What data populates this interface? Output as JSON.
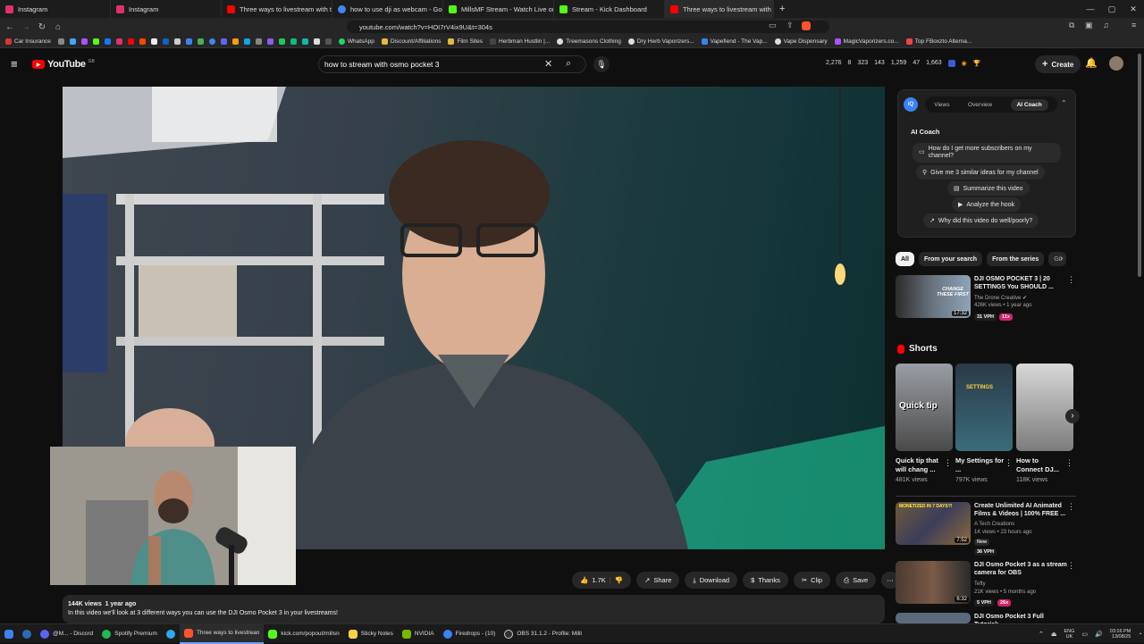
{
  "browser": {
    "tabs": [
      {
        "label": "Instagram",
        "color": "#e1306c"
      },
      {
        "label": "Instagram",
        "color": "#e1306c"
      },
      {
        "label": "Three ways to livestream with the DJI",
        "color": "#ff0000"
      },
      {
        "label": "how to use dji as webcam - Google S",
        "color": "#4285f4"
      },
      {
        "label": "MillsMF Stream - Watch Live on Kick",
        "color": "#53fc18"
      },
      {
        "label": "Stream - Kick Dashboard",
        "color": "#53fc18"
      },
      {
        "label": "Three ways to livestream with",
        "color": "#ff0000"
      }
    ],
    "url": "youtube.com/watch?v=HOI7rV4ix9U&t=304s",
    "bookmarks": [
      "Car Insurance",
      "WhatsApp",
      "Discount/Affiliations",
      "Film Sites",
      "Herbman Hustlin |...",
      "Treemasons Clothing",
      "Dry Herb Vaporizers...",
      "Vapefiend - The Vap...",
      "Vape Dispensary",
      "MagicVaporizers.co...",
      "Top FBoxzto Alterna..."
    ]
  },
  "youtube": {
    "logo": "YouTube",
    "country": "GB",
    "search_value": "how to stream with osmo pocket 3",
    "stats": [
      "2,276",
      "8",
      "323",
      "143",
      "1,259",
      "47",
      "1,663"
    ],
    "create_label": "Create"
  },
  "video": {
    "likes": "1.7K",
    "share": "Share",
    "download": "Download",
    "thanks": "Thanks",
    "clip": "Clip",
    "save": "Save",
    "views": "144K views",
    "age": "1 year ago",
    "description": "In this video we'll look at 3 different ways you can use the DJI Osmo Pocket 3 in your livestreams!"
  },
  "aicoach": {
    "tabs": [
      "Views",
      "Overview",
      "AI Coach"
    ],
    "title": "AI Coach",
    "suggestions": [
      "How do I get more subscribers on my channel?",
      "Give me 3 similar ideas for my channel",
      "Summarize this video",
      "Analyze the hook",
      "Why did this video do well/poorly?"
    ]
  },
  "chips": [
    "All",
    "From your search",
    "From the series",
    "Gi"
  ],
  "recs": [
    {
      "title": "DJI OSMO POCKET 3 | 20 SETTINGS You SHOULD ...",
      "channel": "The Drone Creative",
      "meta": "426K views • 1 year ago",
      "duration": "17:32",
      "vph": "31 VPH",
      "x": "11x",
      "thumb_text": "CHANGE THESE FIRST"
    },
    {
      "title": "Create Unlimited AI Animated Films & Videos | 100% FREE ...",
      "channel": "A Tech Creations",
      "meta": "1K views • 23 hours ago",
      "duration": "7:52",
      "new": "New",
      "vph": "36 VPH",
      "thumb_text": "MONETIZED IN 7 DAYS?!"
    },
    {
      "title": "DJI Osmo Pocket 3 as a stream camera for OBS",
      "channel": "Tefty",
      "meta": "21K views • 5 months ago",
      "duration": "6:32",
      "vph": "5 VPH",
      "x": "26x"
    },
    {
      "title": "DJI Osmo Pocket 3 Full Tutorial:"
    }
  ],
  "shorts": {
    "heading": "Shorts",
    "items": [
      {
        "title": "Quick tip that will chang ...",
        "views": "481K views",
        "overlay": "Quick tip"
      },
      {
        "title": "My Settings for ...",
        "views": "797K views",
        "overlay": "SETTINGS"
      },
      {
        "title": "How to Connect DJ...",
        "views": "118K views"
      }
    ]
  },
  "taskbar": {
    "items": [
      {
        "label": "@M... - Discord",
        "color": "#5865f2"
      },
      {
        "label": "Spotify Premium",
        "color": "#1db954"
      },
      {
        "label": "Three ways to livestrean",
        "color": "#ff0000"
      },
      {
        "label": "kick.com/popout/millsn",
        "color": "#53fc18"
      },
      {
        "label": "Sticky Notes",
        "color": "#f7d23e"
      },
      {
        "label": "NVIDIA",
        "color": "#76b900"
      },
      {
        "label": "Firedrops - (10)",
        "color": "#3b82f6"
      },
      {
        "label": "OBS 31.1.2 - Profile: Milli",
        "color": "#cccccc"
      }
    ],
    "lang": "ENG",
    "region": "UK",
    "time": "03:16 PM",
    "date": "13/08/25"
  }
}
